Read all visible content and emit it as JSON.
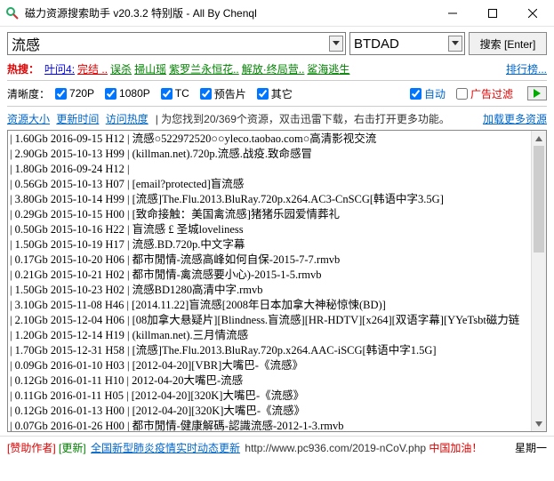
{
  "window": {
    "title": "磁力资源搜索助手 v20.3.2 特别版 - All By Chenql"
  },
  "search": {
    "query": "流感",
    "engine": "BTDAD",
    "button": "搜索 [Enter]"
  },
  "hot": {
    "label": "热搜：",
    "items": [
      "叶问4:",
      "完结 ..",
      "误杀",
      "掃山瑶",
      "紫罗兰永恒花..",
      "解放·终局营..",
      "鲨海逃生"
    ],
    "rank": "排行榜..."
  },
  "filters": {
    "label": "清晰度：",
    "q720": "720P",
    "q1080": "1080P",
    "tc": "TC",
    "trailer": "预告片",
    "other": "其它",
    "auto": "自动",
    "adfilter": "广告过滤"
  },
  "sort": {
    "size": "资源大小",
    "time": "更新时间",
    "hot": "访问热度",
    "info": "| 为您找到20/369个资源，双击迅雷下载，右击打开更多功能。",
    "more": "加载更多资源"
  },
  "results": [
    "| 1.60Gb 2016-09-15 H12 | 流感○522972520○○yleco.taobao.com○高清影视交流",
    "| 2.90Gb 2015-10-13 H99 | (killman.net).720p.流感.战疫.致命感冒",
    "| 1.80Gb 2016-09-24 H12 |",
    "| 0.56Gb 2015-10-13 H07 | [email?protected]盲流感",
    "| 3.80Gb 2015-10-14 H99 | [流感]The.Flu.2013.BluRay.720p.x264.AC3-CnSCG[韩语中字3.5G]",
    "| 0.29Gb 2015-10-15 H00 | [致命接触：美国禽流感]猪猪乐园爱情葬礼",
    "| 0.50Gb 2015-10-16 H22 | 盲流感 £ 圣城loveliness",
    "| 1.50Gb 2015-10-19 H17 | 流感.BD.720p.中文字幕",
    "| 0.17Gb 2015-10-20 H06 | 都市閒情-流感高峰如何自保-2015-7-7.rmvb",
    "| 0.21Gb 2015-10-21 H02 | 都市閒情-禽流感要小心)-2015-1-5.rmvb",
    "| 1.50Gb 2015-10-23 H02 | 流感BD1280高清中字.rmvb",
    "| 3.10Gb 2015-11-08 H46 | [2014.11.22]盲流感[2008年日本加拿大神秘惊悚(BD)]",
    "| 2.10Gb 2015-12-04 H06 | [08加拿大悬疑片][Blindness.盲流感][HR-HDTV][x264][双语字幕][YYeTsbt磁力链",
    "| 1.20Gb 2015-12-14 H19 | (killman.net).三月情流感",
    "| 1.70Gb 2015-12-31 H58 | [流感]The.Flu.2013.BluRay.720p.x264.AAC-iSCG[韩语中字1.5G]",
    "| 0.09Gb 2016-01-10 H03 | [2012-04-20][VBR]大嘴巴-《流感》",
    "| 0.12Gb 2016-01-11 H10 | 2012-04-20大嘴巴-流感",
    "| 0.11Gb 2016-01-11 H05 | [2012-04-20][320K]大嘴巴-《流感》",
    "| 0.12Gb 2016-01-13 H00 | [2012-04-20][320K]大嘴巴-《流感》",
    "| 0.07Gb 2016-01-26 H00 | 都市閒情-健康解碼-認識流感-2012-1-3.rmvb"
  ],
  "footer": {
    "sponsor": "[赞助作者]",
    "update": "[更新]",
    "news": "全国新型肺炎疫情实时动态更新",
    "url": "http://www.pc936.com/2019-nCoV.php",
    "cheer": "中国加油！",
    "week": "星期一"
  }
}
